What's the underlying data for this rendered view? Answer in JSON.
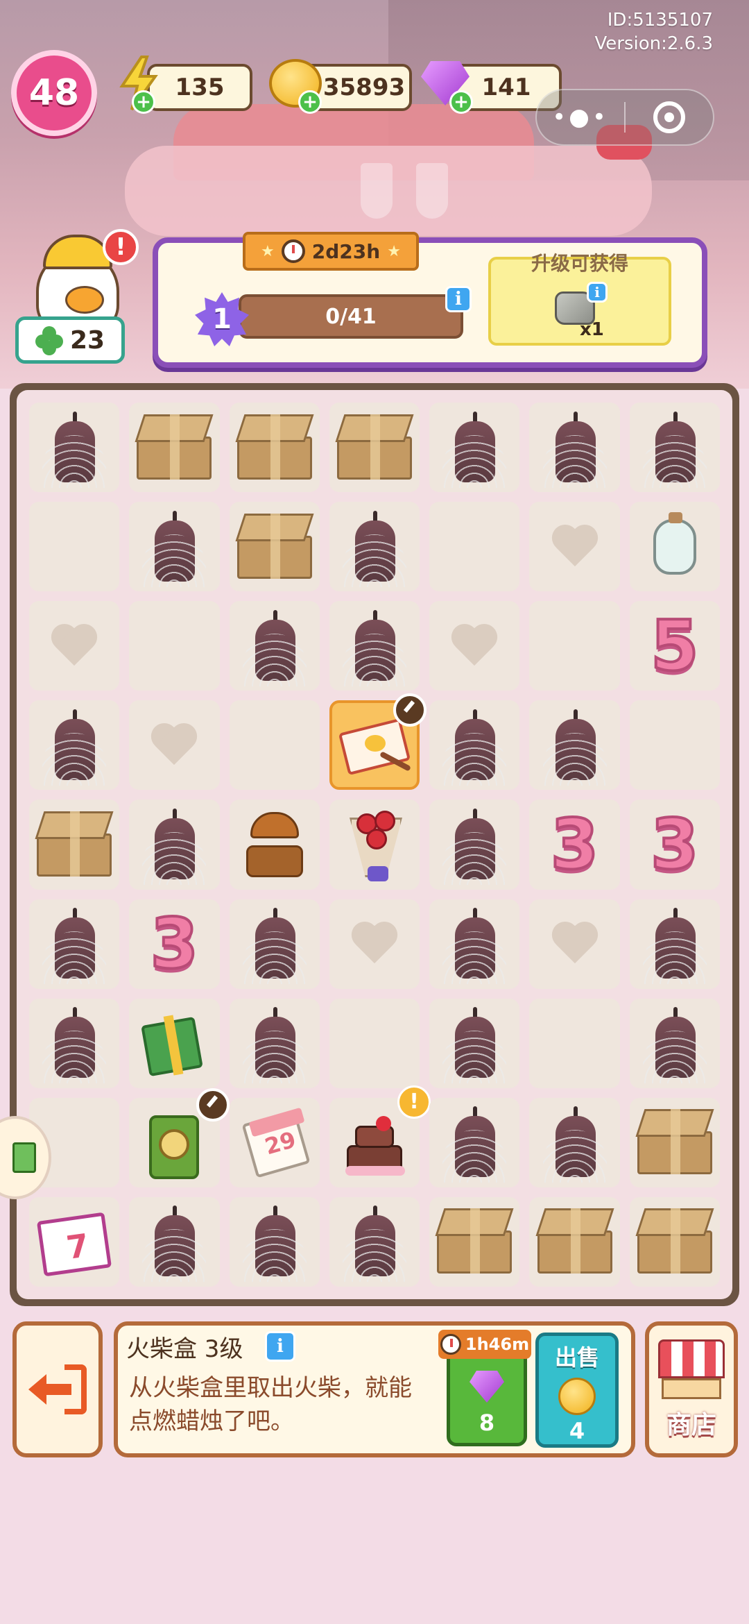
{
  "meta": {
    "id_label": "ID:5135107",
    "version_label": "Version:2.6.3"
  },
  "player": {
    "level": "48",
    "energy": "135",
    "coins": "35893",
    "gems": "141",
    "clover_count": "23"
  },
  "mini_program": {
    "menu_icon": "more-dots-icon",
    "close_icon": "target-circle-icon"
  },
  "quest": {
    "timer": "2d23h",
    "level": "1",
    "progress_text": "0/41",
    "reward_title": "升级可获得",
    "reward_count": "x1"
  },
  "board": {
    "rows": [
      [
        "candle",
        "box",
        "box",
        "box",
        "candle",
        "candle",
        "candle"
      ],
      [
        "empty",
        "candle",
        "box",
        "candle",
        "empty",
        "heart",
        "bottle"
      ],
      [
        "heart",
        "empty",
        "candle",
        "candle",
        "heart",
        "empty",
        "num5"
      ],
      [
        "candle",
        "heart",
        "empty",
        "matchbox",
        "candle",
        "candle",
        "empty"
      ],
      [
        "box",
        "candle",
        "musicbox",
        "bouquet",
        "candle",
        "num3",
        "num3"
      ],
      [
        "candle",
        "num3",
        "candle",
        "heart",
        "candle",
        "heart",
        "candle"
      ],
      [
        "candle",
        "gift",
        "candle",
        "empty",
        "candle",
        "empty",
        "candle"
      ],
      [
        "empty",
        "clockbox",
        "calendar",
        "cake",
        "candle",
        "candle",
        "box"
      ],
      [
        "cal7",
        "candle",
        "candle",
        "candle",
        "box",
        "box",
        "box"
      ]
    ],
    "labels": {
      "num5": "5",
      "num3": "3",
      "calendar_day": "29",
      "cal7_day": "7"
    }
  },
  "selected_item": {
    "name": "火柴盒 3级",
    "description": "从火柴盒里取出火柴，就能点燃蜡烛了吧。",
    "timer": "1h46m",
    "gem_cost": "8",
    "sell_label": "出售",
    "sell_value": "4"
  },
  "shop": {
    "label": "商店"
  },
  "colors": {
    "accent_purple": "#8a4fb8",
    "board_frame": "#6b5443",
    "selected_cell": "#f9c25f"
  }
}
